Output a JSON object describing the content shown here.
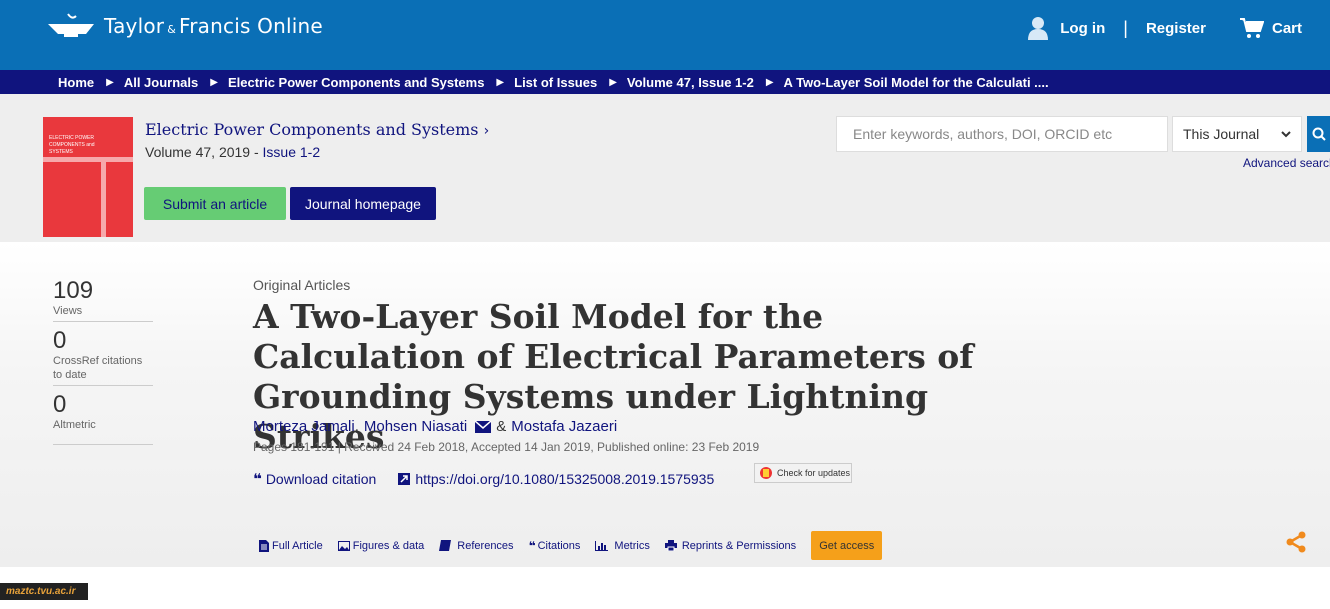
{
  "header": {
    "logo_text": "Taylor",
    "logo_amp": "&",
    "logo_text2": "Francis Online",
    "login": "Log in",
    "separator": "|",
    "register": "Register",
    "cart": "Cart"
  },
  "breadcrumb": {
    "items": [
      "Home",
      "All Journals",
      "Electric Power Components and Systems",
      "List of Issues",
      "Volume 47, Issue 1-2",
      "A Two-Layer Soil Model for the Calculati ...."
    ]
  },
  "journal": {
    "title": "Electric Power Components and Systems",
    "volume": "Volume 47, 2019",
    "issue_sep": " - ",
    "issue": "Issue 1-2",
    "submit_label": "Submit an article",
    "homepage_label": "Journal homepage",
    "cover_text": "ELECTRIC POWER COMPONENTS and SYSTEMS"
  },
  "search": {
    "placeholder": "Enter keywords, authors, DOI, ORCID etc",
    "scope": "This Journal",
    "advanced": "Advanced search"
  },
  "metrics": [
    {
      "value": "109",
      "label": "Views"
    },
    {
      "value": "0",
      "label": "CrossRef citations to date"
    },
    {
      "value": "0",
      "label": "Altmetric"
    }
  ],
  "article": {
    "type": "Original Articles",
    "title": "A Two-Layer Soil Model for the Calculation of Electrical Parameters of Grounding Systems under Lightning Strikes",
    "author1": "Morteza Jamali",
    "comma": ",",
    "author2": "Mohsen Niasati",
    "amp": "&",
    "author3": "Mostafa Jazaeri",
    "pages_line": "Pages 181-191 | Received 24 Feb 2018, Accepted 14 Jan 2019, Published online: 23 Feb 2019",
    "download_citation": "Download citation",
    "doi": "https://doi.org/10.1080/15325008.2019.1575935",
    "check_updates": "Check for updates"
  },
  "tabs": [
    {
      "label": "Full Article",
      "icon": "document-icon"
    },
    {
      "label": "Figures & data",
      "icon": "image-icon"
    },
    {
      "label": "References",
      "icon": "book-icon"
    },
    {
      "label": "Citations",
      "icon": "quote-icon"
    },
    {
      "label": "Metrics",
      "icon": "bar-chart-icon"
    },
    {
      "label": "Reprints & Permissions",
      "icon": "printer-icon"
    }
  ],
  "get_access": "Get access",
  "watermark": "maztc.tvu.ac.ir",
  "colors": {
    "brand_blue": "#0a6fb6",
    "navy": "#10147e",
    "green": "#66cc74",
    "orange": "#f5a01a"
  }
}
